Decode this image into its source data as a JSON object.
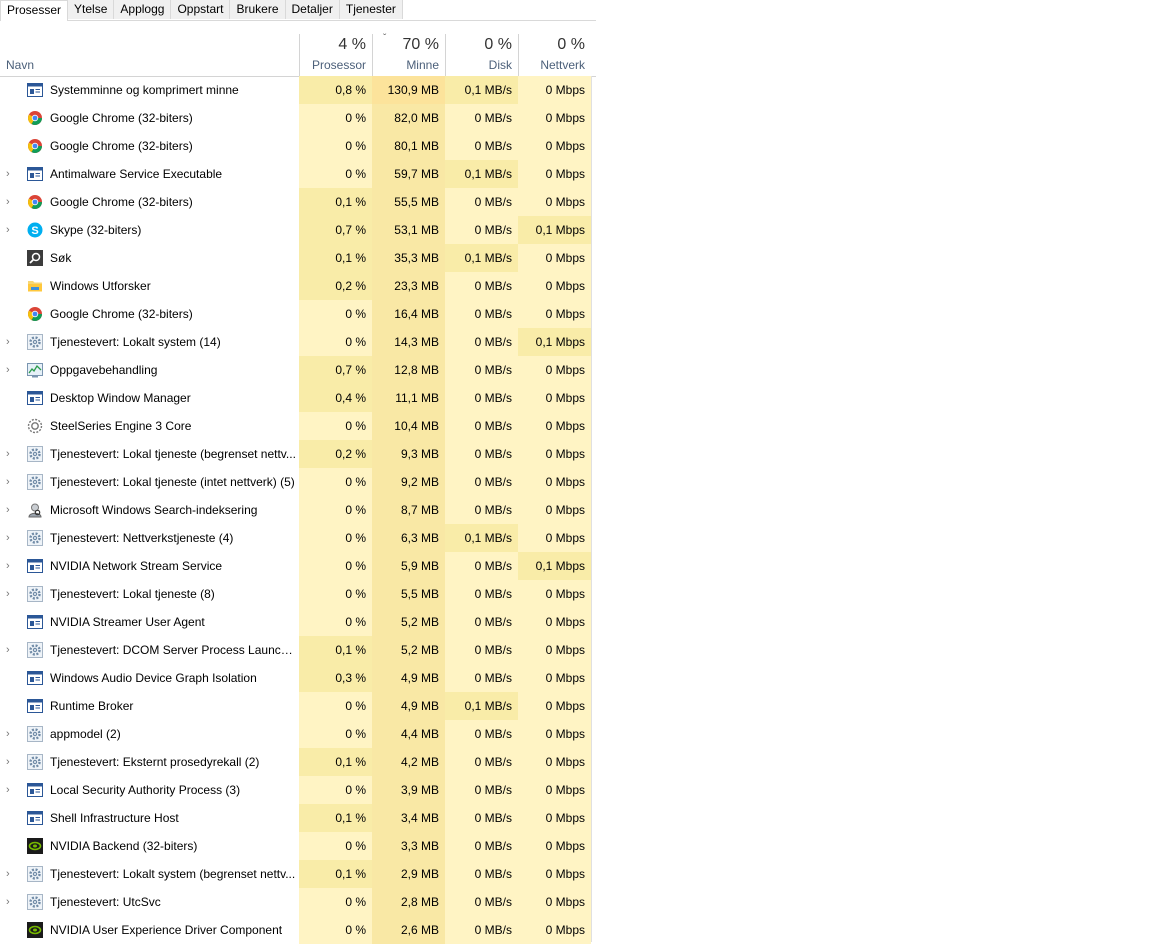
{
  "tabs": [
    "Prosesser",
    "Ytelse",
    "Applogg",
    "Oppstart",
    "Brukere",
    "Detaljer",
    "Tjenester"
  ],
  "active_tab": 0,
  "header": {
    "name": "Navn",
    "cpu": {
      "pct": "4 %",
      "label": "Prosessor"
    },
    "mem": {
      "pct": "70 %",
      "label": "Minne"
    },
    "disk": {
      "pct": "0 %",
      "label": "Disk"
    },
    "net": {
      "pct": "0 %",
      "label": "Nettverk"
    }
  },
  "colors": {
    "heat_light": "#fff4c4",
    "heat_mid": "#f9eca8",
    "heat_high": "#fce39b",
    "mem_col": "#f9e8a5"
  },
  "rows": [
    {
      "name": "Systemminne og komprimert minne",
      "icon": "window-icon",
      "expand": false,
      "cpu": "0,8 %",
      "mem": "130,9 MB",
      "disk": "0,1 MB/s",
      "net": "0 Mbps",
      "cpuLvl": 2,
      "memLvl": 3,
      "diskLvl": 2,
      "netLvl": 1
    },
    {
      "name": "Google Chrome (32-biters)",
      "icon": "chrome-icon",
      "expand": false,
      "cpu": "0 %",
      "mem": "82,0 MB",
      "disk": "0 MB/s",
      "net": "0 Mbps",
      "cpuLvl": 1,
      "memLvl": 2,
      "diskLvl": 1,
      "netLvl": 1
    },
    {
      "name": "Google Chrome (32-biters)",
      "icon": "chrome-icon",
      "expand": false,
      "cpu": "0 %",
      "mem": "80,1 MB",
      "disk": "0 MB/s",
      "net": "0 Mbps",
      "cpuLvl": 1,
      "memLvl": 2,
      "diskLvl": 1,
      "netLvl": 1
    },
    {
      "name": "Antimalware Service Executable",
      "icon": "window-icon",
      "expand": true,
      "cpu": "0 %",
      "mem": "59,7 MB",
      "disk": "0,1 MB/s",
      "net": "0 Mbps",
      "cpuLvl": 1,
      "memLvl": 2,
      "diskLvl": 2,
      "netLvl": 1
    },
    {
      "name": "Google Chrome (32-biters)",
      "icon": "chrome-icon",
      "expand": true,
      "cpu": "0,1 %",
      "mem": "55,5 MB",
      "disk": "0 MB/s",
      "net": "0 Mbps",
      "cpuLvl": 2,
      "memLvl": 2,
      "diskLvl": 1,
      "netLvl": 1
    },
    {
      "name": "Skype (32-biters)",
      "icon": "skype-icon",
      "expand": true,
      "cpu": "0,7 %",
      "mem": "53,1 MB",
      "disk": "0 MB/s",
      "net": "0,1 Mbps",
      "cpuLvl": 2,
      "memLvl": 2,
      "diskLvl": 1,
      "netLvl": 2
    },
    {
      "name": "Søk",
      "icon": "search-icon",
      "expand": false,
      "cpu": "0,1 %",
      "mem": "35,3 MB",
      "disk": "0,1 MB/s",
      "net": "0 Mbps",
      "cpuLvl": 2,
      "memLvl": 2,
      "diskLvl": 2,
      "netLvl": 1
    },
    {
      "name": "Windows Utforsker",
      "icon": "folder-icon",
      "expand": false,
      "cpu": "0,2 %",
      "mem": "23,3 MB",
      "disk": "0 MB/s",
      "net": "0 Mbps",
      "cpuLvl": 2,
      "memLvl": 2,
      "diskLvl": 1,
      "netLvl": 1
    },
    {
      "name": "Google Chrome (32-biters)",
      "icon": "chrome-icon",
      "expand": false,
      "cpu": "0 %",
      "mem": "16,4 MB",
      "disk": "0 MB/s",
      "net": "0 Mbps",
      "cpuLvl": 1,
      "memLvl": 2,
      "diskLvl": 1,
      "netLvl": 1
    },
    {
      "name": "Tjenestevert: Lokalt system (14)",
      "icon": "gear-icon",
      "expand": true,
      "cpu": "0 %",
      "mem": "14,3 MB",
      "disk": "0 MB/s",
      "net": "0,1 Mbps",
      "cpuLvl": 1,
      "memLvl": 2,
      "diskLvl": 1,
      "netLvl": 2
    },
    {
      "name": "Oppgavebehandling",
      "icon": "task-manager-icon",
      "expand": true,
      "cpu": "0,7 %",
      "mem": "12,8 MB",
      "disk": "0 MB/s",
      "net": "0 Mbps",
      "cpuLvl": 2,
      "memLvl": 2,
      "diskLvl": 1,
      "netLvl": 1
    },
    {
      "name": "Desktop Window Manager",
      "icon": "window-icon",
      "expand": false,
      "cpu": "0,4 %",
      "mem": "11,1 MB",
      "disk": "0 MB/s",
      "net": "0 Mbps",
      "cpuLvl": 2,
      "memLvl": 2,
      "diskLvl": 1,
      "netLvl": 1
    },
    {
      "name": "SteelSeries Engine 3 Core",
      "icon": "steelseries-icon",
      "expand": false,
      "cpu": "0 %",
      "mem": "10,4 MB",
      "disk": "0 MB/s",
      "net": "0 Mbps",
      "cpuLvl": 1,
      "memLvl": 2,
      "diskLvl": 1,
      "netLvl": 1
    },
    {
      "name": "Tjenestevert: Lokal tjeneste (begrenset nettv...",
      "icon": "gear-icon",
      "expand": true,
      "cpu": "0,2 %",
      "mem": "9,3 MB",
      "disk": "0 MB/s",
      "net": "0 Mbps",
      "cpuLvl": 2,
      "memLvl": 2,
      "diskLvl": 1,
      "netLvl": 1
    },
    {
      "name": "Tjenestevert: Lokal tjeneste (intet nettverk) (5)",
      "icon": "gear-icon",
      "expand": true,
      "cpu": "0 %",
      "mem": "9,2 MB",
      "disk": "0 MB/s",
      "net": "0 Mbps",
      "cpuLvl": 1,
      "memLvl": 2,
      "diskLvl": 1,
      "netLvl": 1
    },
    {
      "name": "Microsoft Windows Search-indeksering",
      "icon": "search-user-icon",
      "expand": true,
      "cpu": "0 %",
      "mem": "8,7 MB",
      "disk": "0 MB/s",
      "net": "0 Mbps",
      "cpuLvl": 1,
      "memLvl": 2,
      "diskLvl": 1,
      "netLvl": 1
    },
    {
      "name": "Tjenestevert: Nettverkstjeneste (4)",
      "icon": "gear-icon",
      "expand": true,
      "cpu": "0 %",
      "mem": "6,3 MB",
      "disk": "0,1 MB/s",
      "net": "0 Mbps",
      "cpuLvl": 1,
      "memLvl": 2,
      "diskLvl": 2,
      "netLvl": 1
    },
    {
      "name": "NVIDIA Network Stream Service",
      "icon": "window-icon",
      "expand": true,
      "cpu": "0 %",
      "mem": "5,9 MB",
      "disk": "0 MB/s",
      "net": "0,1 Mbps",
      "cpuLvl": 1,
      "memLvl": 2,
      "diskLvl": 1,
      "netLvl": 2
    },
    {
      "name": "Tjenestevert: Lokal tjeneste (8)",
      "icon": "gear-icon",
      "expand": true,
      "cpu": "0 %",
      "mem": "5,5 MB",
      "disk": "0 MB/s",
      "net": "0 Mbps",
      "cpuLvl": 1,
      "memLvl": 2,
      "diskLvl": 1,
      "netLvl": 1
    },
    {
      "name": "NVIDIA Streamer User Agent",
      "icon": "window-icon",
      "expand": false,
      "cpu": "0 %",
      "mem": "5,2 MB",
      "disk": "0 MB/s",
      "net": "0 Mbps",
      "cpuLvl": 1,
      "memLvl": 2,
      "diskLvl": 1,
      "netLvl": 1
    },
    {
      "name": "Tjenestevert: DCOM Server Process Launche...",
      "icon": "gear-icon",
      "expand": true,
      "cpu": "0,1 %",
      "mem": "5,2 MB",
      "disk": "0 MB/s",
      "net": "0 Mbps",
      "cpuLvl": 2,
      "memLvl": 2,
      "diskLvl": 1,
      "netLvl": 1
    },
    {
      "name": "Windows Audio Device Graph Isolation",
      "icon": "window-icon",
      "expand": false,
      "cpu": "0,3 %",
      "mem": "4,9 MB",
      "disk": "0 MB/s",
      "net": "0 Mbps",
      "cpuLvl": 2,
      "memLvl": 2,
      "diskLvl": 1,
      "netLvl": 1
    },
    {
      "name": "Runtime Broker",
      "icon": "window-icon",
      "expand": false,
      "cpu": "0 %",
      "mem": "4,9 MB",
      "disk": "0,1 MB/s",
      "net": "0 Mbps",
      "cpuLvl": 1,
      "memLvl": 2,
      "diskLvl": 2,
      "netLvl": 1
    },
    {
      "name": "appmodel (2)",
      "icon": "gear-icon",
      "expand": true,
      "cpu": "0 %",
      "mem": "4,4 MB",
      "disk": "0 MB/s",
      "net": "0 Mbps",
      "cpuLvl": 1,
      "memLvl": 2,
      "diskLvl": 1,
      "netLvl": 1
    },
    {
      "name": "Tjenestevert: Eksternt prosedyrekall (2)",
      "icon": "gear-icon",
      "expand": true,
      "cpu": "0,1 %",
      "mem": "4,2 MB",
      "disk": "0 MB/s",
      "net": "0 Mbps",
      "cpuLvl": 2,
      "memLvl": 2,
      "diskLvl": 1,
      "netLvl": 1
    },
    {
      "name": "Local Security Authority Process (3)",
      "icon": "window-icon",
      "expand": true,
      "cpu": "0 %",
      "mem": "3,9 MB",
      "disk": "0 MB/s",
      "net": "0 Mbps",
      "cpuLvl": 1,
      "memLvl": 2,
      "diskLvl": 1,
      "netLvl": 1
    },
    {
      "name": "Shell Infrastructure Host",
      "icon": "window-icon",
      "expand": false,
      "cpu": "0,1 %",
      "mem": "3,4 MB",
      "disk": "0 MB/s",
      "net": "0 Mbps",
      "cpuLvl": 2,
      "memLvl": 2,
      "diskLvl": 1,
      "netLvl": 1
    },
    {
      "name": "NVIDIA Backend (32-biters)",
      "icon": "nvidia-icon",
      "expand": false,
      "cpu": "0 %",
      "mem": "3,3 MB",
      "disk": "0 MB/s",
      "net": "0 Mbps",
      "cpuLvl": 1,
      "memLvl": 2,
      "diskLvl": 1,
      "netLvl": 1
    },
    {
      "name": "Tjenestevert: Lokalt system (begrenset nettv...",
      "icon": "gear-icon",
      "expand": true,
      "cpu": "0,1 %",
      "mem": "2,9 MB",
      "disk": "0 MB/s",
      "net": "0 Mbps",
      "cpuLvl": 2,
      "memLvl": 2,
      "diskLvl": 1,
      "netLvl": 1
    },
    {
      "name": "Tjenestevert: UtcSvc",
      "icon": "gear-icon",
      "expand": true,
      "cpu": "0 %",
      "mem": "2,8 MB",
      "disk": "0 MB/s",
      "net": "0 Mbps",
      "cpuLvl": 1,
      "memLvl": 2,
      "diskLvl": 1,
      "netLvl": 1
    },
    {
      "name": "NVIDIA User Experience Driver Component",
      "icon": "nvidia-icon",
      "expand": false,
      "cpu": "0 %",
      "mem": "2,6 MB",
      "disk": "0 MB/s",
      "net": "0 Mbps",
      "cpuLvl": 1,
      "memLvl": 2,
      "diskLvl": 1,
      "netLvl": 1
    }
  ]
}
